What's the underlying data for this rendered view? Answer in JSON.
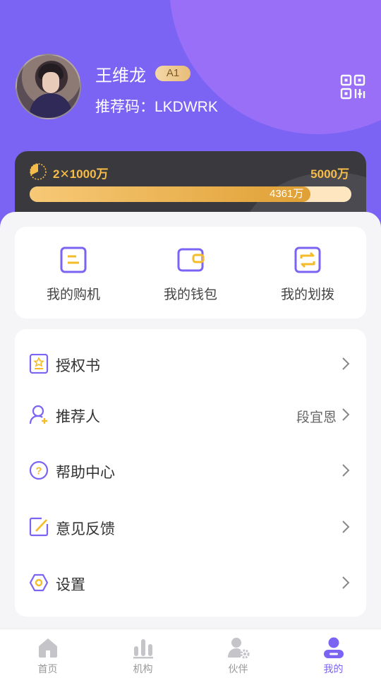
{
  "profile": {
    "name": "王维龙",
    "level": "A1",
    "referral": "推荐码：LKDWRK"
  },
  "vip": {
    "current_label": "2✕1000万",
    "target_label": "5000万",
    "progress_label": "4361万",
    "progress_fraction": 0.8722,
    "colors": {
      "accent": "#f5bc4a",
      "card": "#3a3a3e"
    }
  },
  "quick_actions": [
    {
      "label": "我的购机",
      "icon": "note-icon"
    },
    {
      "label": "我的钱包",
      "icon": "wallet-icon"
    },
    {
      "label": "我的划拨",
      "icon": "transfer-icon"
    }
  ],
  "menu": [
    {
      "label": "授权书",
      "value": "",
      "icon": "certificate-icon"
    },
    {
      "label": "推荐人",
      "value": "段宜恩",
      "icon": "add-user-icon"
    },
    {
      "label": "帮助中心",
      "value": "",
      "icon": "help-icon"
    },
    {
      "label": "意见反馈",
      "value": "",
      "icon": "edit-icon"
    },
    {
      "label": "设置",
      "value": "",
      "icon": "settings-icon"
    }
  ],
  "tabs": [
    {
      "label": "首页",
      "icon": "home-icon",
      "active": false
    },
    {
      "label": "机构",
      "icon": "bar-chart-icon",
      "active": false
    },
    {
      "label": "伙伴",
      "icon": "partner-icon",
      "active": false
    },
    {
      "label": "我的",
      "icon": "profile-icon",
      "active": true
    }
  ],
  "theme": {
    "primary": "#7b63f4",
    "icon_yellow": "#f5bc2a"
  }
}
